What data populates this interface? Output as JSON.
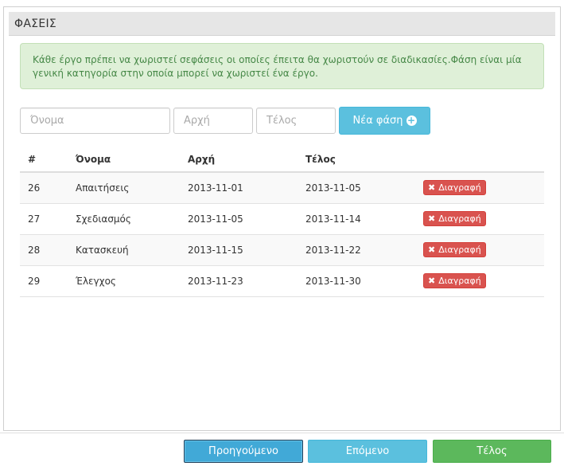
{
  "panel": {
    "title": "ΦΑΣΕΙΣ",
    "info": "Κάθε έργο πρέπει να χωριστεί σεφάσεις οι οποίες έπειτα θα χωριστούν σε διαδικασίες.Φάση είναι μία γενική κατηγορία στην οποία μπορεί να χωριστεί ένα έργο."
  },
  "form": {
    "name_placeholder": "Όνομα",
    "start_placeholder": "Αρχή",
    "end_placeholder": "Τέλος",
    "new_phase_label": "Νέα φάση"
  },
  "table": {
    "headers": [
      "#",
      "Όνομα",
      "Αρχή",
      "Τέλος"
    ],
    "rows": [
      {
        "id": "26",
        "name": "Απαιτήσεις",
        "start": "2013-11-01",
        "end": "2013-11-05",
        "action": "Διαγραφή"
      },
      {
        "id": "27",
        "name": "Σχεδιασμός",
        "start": "2013-11-05",
        "end": "2013-11-14",
        "action": "Διαγραφή"
      },
      {
        "id": "28",
        "name": "Κατασκευή",
        "start": "2013-11-15",
        "end": "2013-11-22",
        "action": "Διαγραφή"
      },
      {
        "id": "29",
        "name": "Έλεγχος",
        "start": "2013-11-23",
        "end": "2013-11-30",
        "action": "Διαγραφή"
      }
    ]
  },
  "footer": {
    "prev_label": "Προηγούμενο",
    "next_label": "Επόμενο",
    "finish_label": "Τέλος"
  },
  "icons": {
    "plus": "plus-circle-icon",
    "delete": "x-icon"
  },
  "colors": {
    "info_bg": "#dff0d8",
    "info_text": "#468847",
    "primary": "#5bc0de",
    "danger": "#d9534f",
    "success": "#5cb85c"
  }
}
